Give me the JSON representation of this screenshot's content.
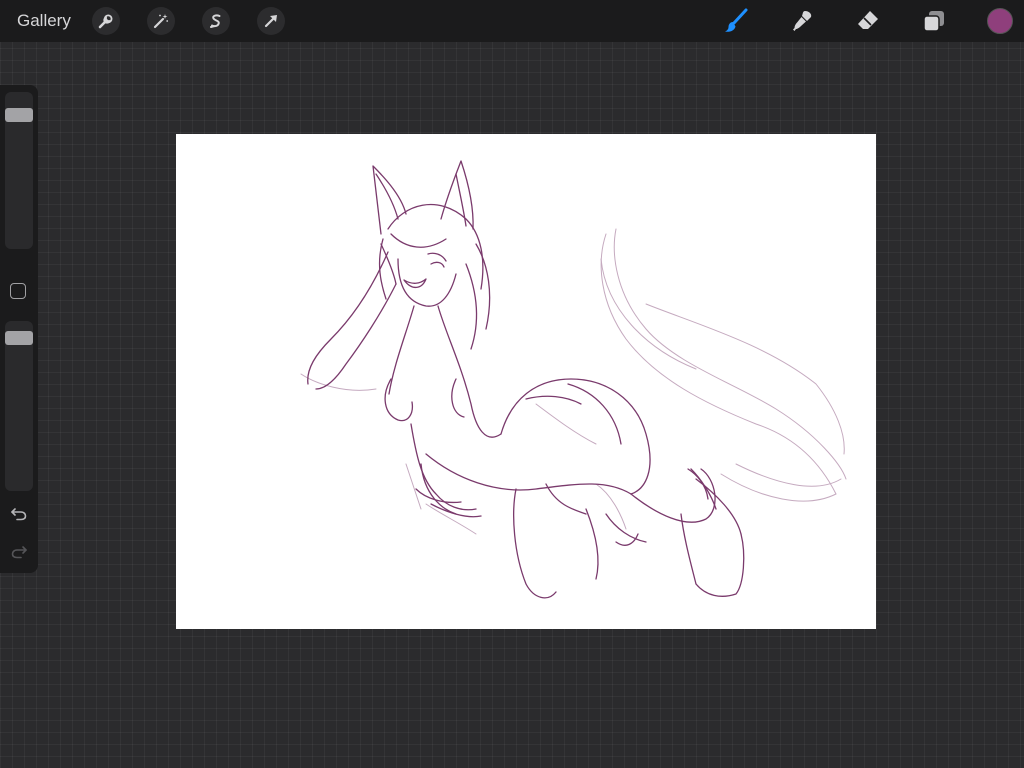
{
  "topbar": {
    "gallery_label": "Gallery",
    "left_tools": [
      {
        "name": "actions",
        "icon": "wrench-icon"
      },
      {
        "name": "adjustments",
        "icon": "magic-wand-icon"
      },
      {
        "name": "selection",
        "icon": "selection-s-icon"
      },
      {
        "name": "transform",
        "icon": "arrow-cursor-icon"
      }
    ],
    "right_tools": [
      {
        "name": "brush",
        "icon": "brush-icon",
        "active": true
      },
      {
        "name": "smudge",
        "icon": "smudge-icon",
        "active": false
      },
      {
        "name": "eraser",
        "icon": "eraser-icon",
        "active": false
      },
      {
        "name": "layers",
        "icon": "layers-icon",
        "active": false
      }
    ],
    "current_color": "#8f3f7c",
    "active_tool_color": "#1e90ff"
  },
  "sidebar": {
    "brush_size_level": 0.9,
    "opacity_level": 0.95,
    "undo_icon": "undo-icon",
    "redo_icon": "redo-icon"
  },
  "canvas": {
    "background": "#ffffff",
    "sketch_color": "#7a3a6c",
    "sketch_light_color": "#b795b0"
  }
}
